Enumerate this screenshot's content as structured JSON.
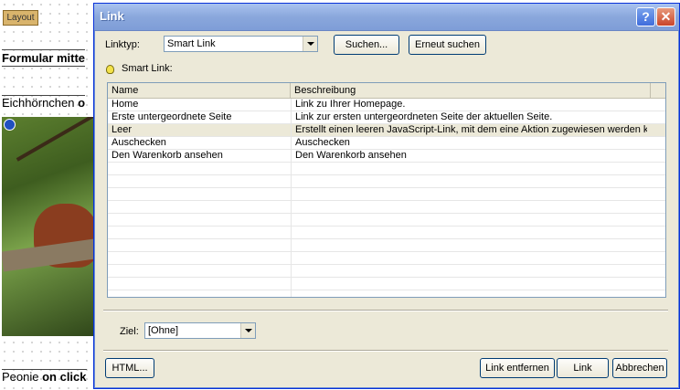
{
  "background_page": {
    "layout_tag": "Layout",
    "line1": "Formular mitte",
    "line2_prefix": "Eichhörnchen ",
    "line2_bold": "o",
    "line3_prefix": "Peonie ",
    "line3_bold": "on click"
  },
  "dialog": {
    "title": "Link",
    "help_glyph": "?",
    "close_glyph": "✕",
    "linktype_label": "Linktyp:",
    "linktype_value": "Smart Link",
    "search_button": "Suchen...",
    "search_again_button": "Erneut suchen",
    "info_label": "Smart Link:",
    "columns": [
      "Name",
      "Beschreibung"
    ],
    "rows": [
      {
        "name": "Home",
        "description": "Link zu Ihrer Homepage.",
        "selected": false
      },
      {
        "name": "Erste untergeordnete Seite",
        "description": "Link zur ersten untergeordneten Seite der aktuellen Seite.",
        "selected": false
      },
      {
        "name": "Leer",
        "description": "Erstellt einen leeren JavaScript-Link, mit dem eine Aktion zugewiesen werden k...",
        "selected": true
      },
      {
        "name": "Auschecken",
        "description": "Auschecken",
        "selected": false
      },
      {
        "name": "Den Warenkorb ansehen",
        "description": "Den Warenkorb ansehen",
        "selected": false
      }
    ],
    "empty_rows": 10,
    "target_label": "Ziel:",
    "target_value": "[Ohne]",
    "html_button": "HTML...",
    "remove_link_button": "Link entfernen",
    "link_button": "Link",
    "cancel_button": "Abbrechen"
  }
}
